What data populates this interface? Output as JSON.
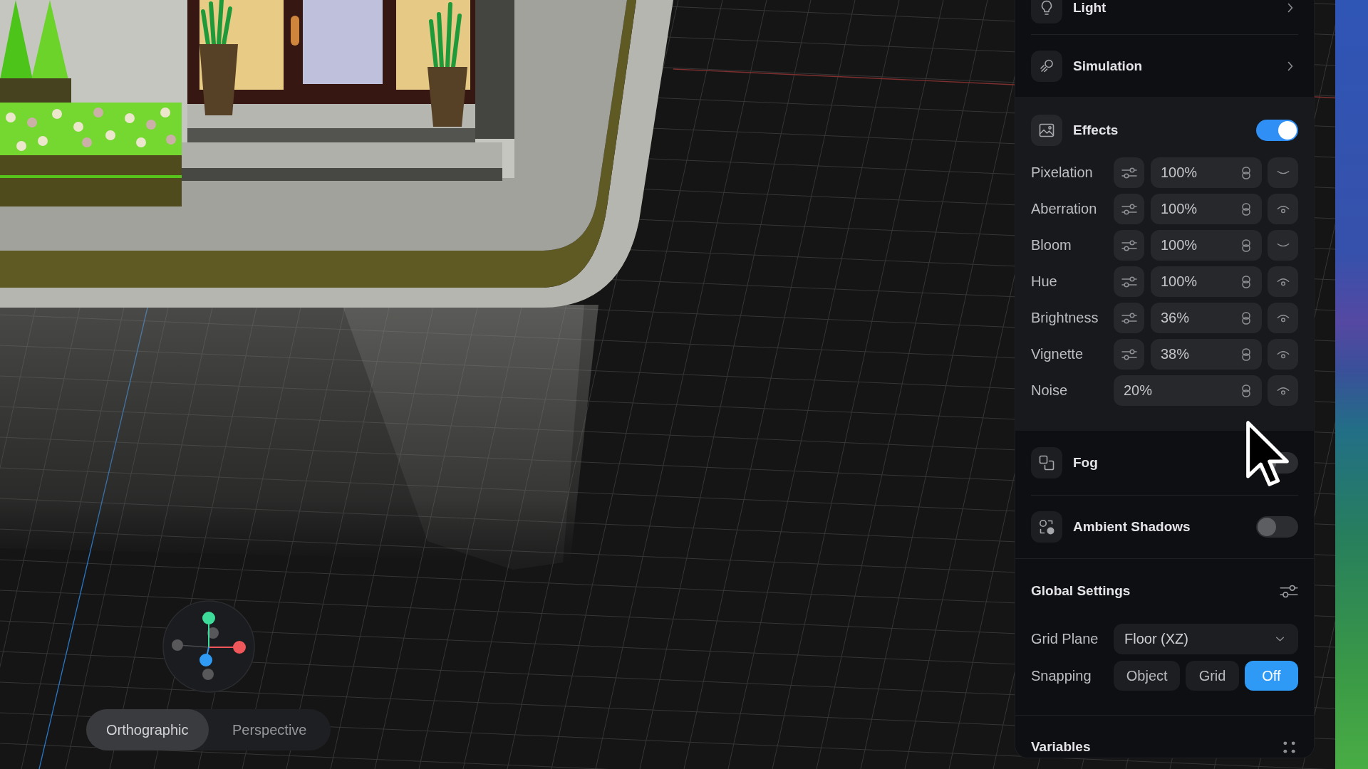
{
  "viewport": {
    "view_modes": [
      {
        "label": "Orthographic",
        "selected": true
      },
      {
        "label": "Perspective",
        "selected": false
      }
    ]
  },
  "panel": {
    "nav_items": [
      {
        "label": "Light"
      },
      {
        "label": "Simulation"
      }
    ],
    "effects": {
      "title": "Effects",
      "on": true,
      "items": [
        {
          "kind": "slider",
          "label": "Pixelation",
          "value": "100%",
          "visible": false
        },
        {
          "kind": "slider",
          "label": "Aberration",
          "value": "100%",
          "visible": true
        },
        {
          "kind": "slider",
          "label": "Bloom",
          "value": "100%",
          "visible": false
        },
        {
          "kind": "slider",
          "label": "Hue",
          "value": "100%",
          "visible": true
        },
        {
          "kind": "slider",
          "label": "Brightness",
          "value": "36%",
          "visible": true
        },
        {
          "kind": "slider",
          "label": "Vignette",
          "value": "38%",
          "visible": true
        },
        {
          "kind": "number",
          "label": "Noise",
          "value": "20%",
          "visible": true
        }
      ]
    },
    "toggles": [
      {
        "label": "Fog",
        "on": false
      },
      {
        "label": "Ambient Shadows",
        "on": false
      }
    ],
    "global_settings": {
      "title": "Global Settings",
      "grid_plane": {
        "label": "Grid Plane",
        "value": "Floor (XZ)"
      },
      "snapping": {
        "label": "Snapping",
        "options": [
          {
            "label": "Object",
            "selected": false
          },
          {
            "label": "Grid",
            "selected": false
          },
          {
            "label": "Off",
            "selected": true
          }
        ]
      }
    },
    "variables": {
      "title": "Variables"
    }
  }
}
